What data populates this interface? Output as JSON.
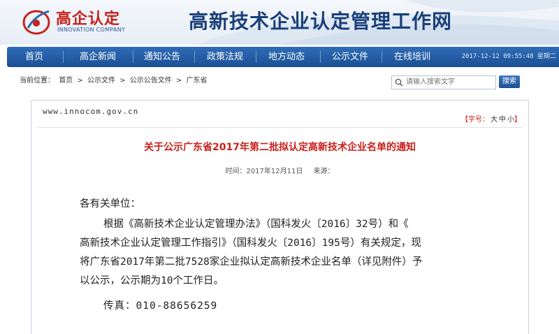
{
  "brand": {
    "logo_text": "高企认定",
    "logo_sub": "INNOVATION COMPANY",
    "site_title": "高新技术企业认定管理工作网"
  },
  "nav": {
    "items": [
      "首页",
      "高企新闻",
      "通知公告",
      "政策法规",
      "地方动态",
      "公示文件",
      "在线培训"
    ],
    "datetime": "2017-12-12 09:55:48 星期二"
  },
  "breadcrumb": {
    "prefix": "当前位置：",
    "path": [
      "首页",
      ">",
      "公示文件",
      ">",
      "公示公告文件",
      ">",
      "广东省"
    ]
  },
  "search": {
    "placeholder": "请输入搜索文字",
    "button_label": "搜索"
  },
  "article": {
    "url": "www.innocom.gov.cn",
    "font_size": {
      "label": "【字号：",
      "large": "大",
      "medium": "中",
      "small": "小",
      "close": "】"
    },
    "title": "关于公示广东省2017年第二批拟认定高新技术企业名单的通知",
    "meta": {
      "time": "时间：2017年12月11日",
      "source": "来源："
    },
    "greeting": "各有关单位：",
    "paragraph_lines": [
      "根据《高新技术企业认定管理办法》（国科发火〔2016〕32号）和《",
      "高新技术企业认定管理工作指引》（国科发火〔2016〕195号）有关规定，现",
      "将广东省2017年第二批7528家企业拟认定高新技术企业名单（详见附件）予",
      "以公示，公示期为10个工作日。"
    ],
    "fax": "传真：010-88656259"
  },
  "colors": {
    "nav_blue": "#1b4f94",
    "title_red": "#c8201b",
    "site_title_blue": "#1a3f7a"
  }
}
